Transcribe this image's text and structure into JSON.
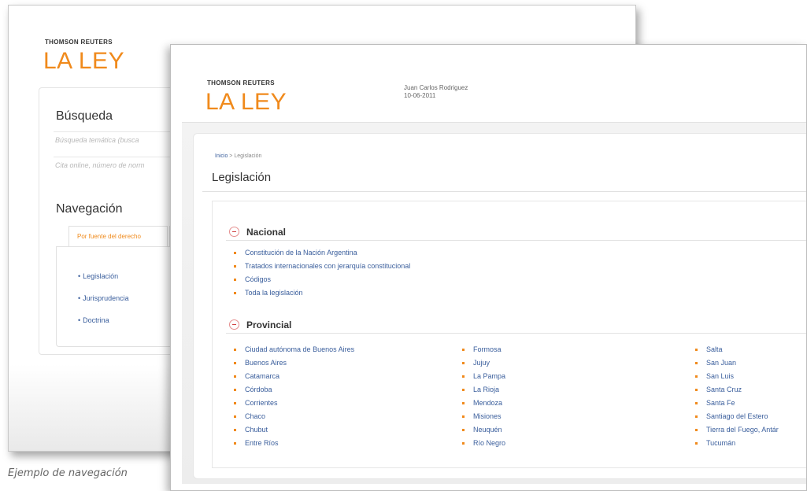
{
  "brand": {
    "small": "THOMSON REUTERS",
    "big": "LA LEY"
  },
  "caption": "Ejemplo de navegación",
  "back_window": {
    "search_heading": "Búsqueda",
    "search_placeholder_1": "Búsqueda temática (busca",
    "search_placeholder_2": "Cita online, número de norm",
    "nav_heading": "Navegación",
    "active_tab": "Por fuente del derecho",
    "nav_links": [
      "Legislación",
      "Jurisprudencia",
      "Doctrina"
    ]
  },
  "front_window": {
    "user_name": "Juan Carlos Rodriguez",
    "date": "10-06-2011",
    "breadcrumb": {
      "home": "Inicio",
      "separator": ">",
      "current": "Legislación"
    },
    "page_title": "Legislación",
    "nacional": {
      "title": "Nacional",
      "links": [
        "Constitución de la Nación Argentina",
        "Tratados internacionales con jerarquía constitucional",
        "Códigos",
        "Toda la legislación"
      ]
    },
    "provincial": {
      "title": "Provincial",
      "col1": [
        "Ciudad autónoma de Buenos Aires",
        "Buenos Aires",
        "Catamarca",
        "Córdoba",
        "Corrientes",
        "Chaco",
        "Chubut",
        "Entre Ríos"
      ],
      "col2": [
        "Formosa",
        "Jujuy",
        "La Pampa",
        "La Rioja",
        "Mendoza",
        "Misiones",
        "Neuquén",
        "Río Negro"
      ],
      "col3": [
        "Salta",
        "San Juan",
        "San Luis",
        "Santa Cruz",
        "Santa Fe",
        "Santiago del Estero",
        "Tierra del Fuego, Antár",
        "Tucumán"
      ]
    }
  },
  "colors": {
    "brand_orange": "#f08a1c",
    "link_blue": "#3a5e9c",
    "toggle_red": "#d04040"
  }
}
